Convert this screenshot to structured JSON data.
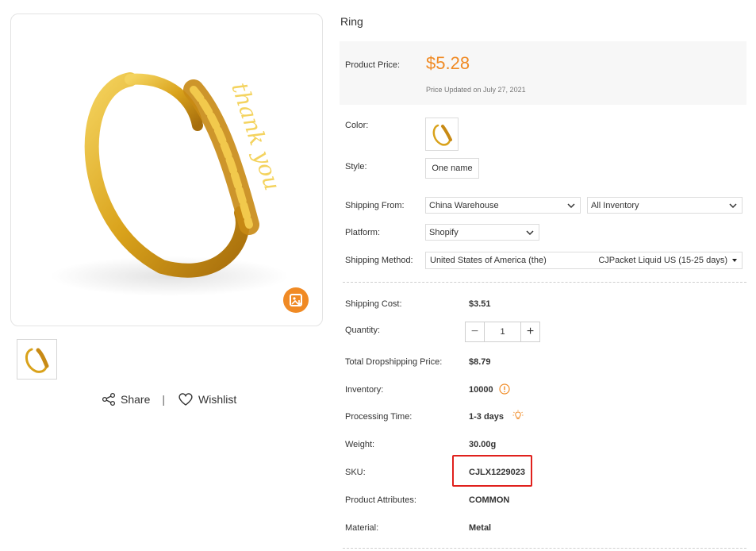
{
  "product": {
    "title": "Ring"
  },
  "gallery": {
    "main_image_alt": "thank you",
    "share_label": "Share",
    "separator": "|",
    "wishlist_label": "Wishlist"
  },
  "price": {
    "label": "Product Price:",
    "value": "$5.28",
    "updated": "Price Updated on July 27, 2021"
  },
  "options": {
    "color_label": "Color:",
    "style_label": "Style:",
    "style_value": "One name",
    "shipping_from_label": "Shipping From:",
    "shipping_from_value": "China Warehouse",
    "inventory_filter_value": "All Inventory",
    "platform_label": "Platform:",
    "platform_value": "Shopify",
    "shipping_method_label": "Shipping Method:",
    "shipping_method_country": "United States of America (the)",
    "shipping_method_carrier": "CJPacket Liquid US (15-25 days)"
  },
  "details": {
    "shipping_cost_label": "Shipping Cost:",
    "shipping_cost": "$3.51",
    "quantity_label": "Quantity:",
    "quantity_minus": "−",
    "quantity_value": "1",
    "quantity_plus": "+",
    "total_label": "Total Dropshipping Price:",
    "total": "$8.79",
    "inventory_label": "Inventory:",
    "inventory": "10000",
    "processing_label": "Processing Time:",
    "processing": "1-3 days",
    "weight_label": "Weight:",
    "weight": "30.00g",
    "sku_label": "SKU:",
    "sku": "CJLX1229023",
    "attributes_label": "Product Attributes:",
    "attributes": "COMMON",
    "material_label": "Material:",
    "material": "Metal"
  },
  "colors": {
    "accent": "#f08a24",
    "highlight": "#e0211d",
    "gold": "#d9a21b"
  }
}
